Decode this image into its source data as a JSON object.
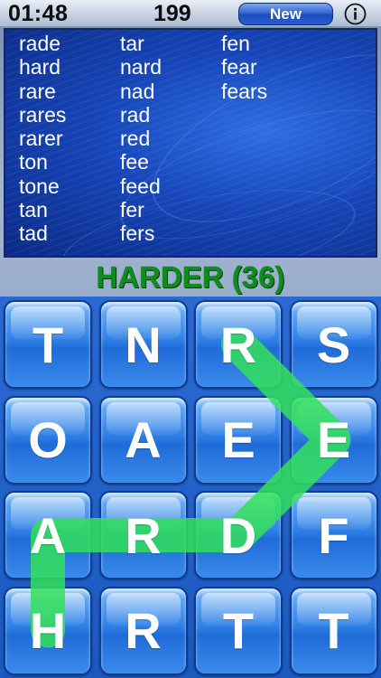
{
  "status": {
    "timer": "01:48",
    "score": "199"
  },
  "controls": {
    "new_label": "New",
    "info_label": "i"
  },
  "found_words": {
    "col1": [
      "rade",
      "hard",
      "rare",
      "rares",
      "rarer",
      "ton",
      "tone",
      "tan",
      "tad"
    ],
    "col2": [
      "tar",
      "nard",
      "nad",
      "rad",
      "red",
      "fee",
      "feed",
      "fer",
      "fers"
    ],
    "col3": [
      "fen",
      "fear",
      "fears"
    ]
  },
  "result": {
    "text": "HARDER (36)",
    "color": "#0a8f1a"
  },
  "board": {
    "rows": [
      [
        "T",
        "N",
        "R",
        "S"
      ],
      [
        "O",
        "A",
        "E",
        "E"
      ],
      [
        "A",
        "R",
        "D",
        "F"
      ],
      [
        "H",
        "R",
        "T",
        "T"
      ]
    ],
    "selected_path": [
      [
        3,
        0
      ],
      [
        2,
        0
      ],
      [
        2,
        1
      ],
      [
        2,
        2
      ],
      [
        1,
        3
      ],
      [
        0,
        2
      ]
    ],
    "path_color": "#33e05a"
  },
  "colors": {
    "background": "#1d5fb8",
    "tile": "#2f7fe6",
    "accent": "#2f62d0"
  }
}
